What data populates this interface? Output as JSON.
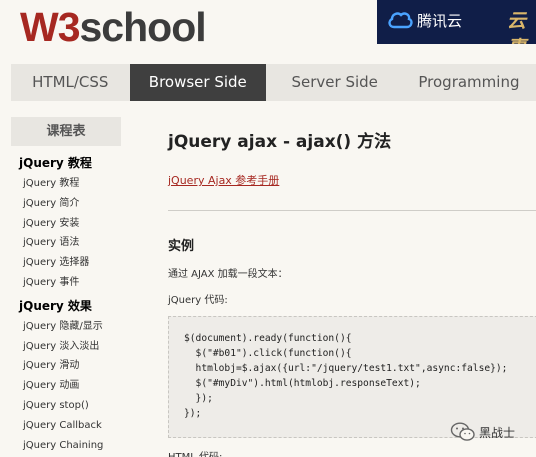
{
  "header": {
    "logo_w3": "W3",
    "logo_school": "school",
    "ad_text": "腾讯云",
    "ad_slogan": "云惠"
  },
  "nav": {
    "tabs": [
      {
        "label": "HTML/CSS",
        "active": false
      },
      {
        "label": "Browser Side",
        "active": true
      },
      {
        "label": "Server Side",
        "active": false
      },
      {
        "label": "Programming",
        "active": false
      }
    ]
  },
  "sidebar": {
    "header": "课程表",
    "groups": [
      {
        "title": "jQuery 教程",
        "items": [
          "jQuery 教程",
          "jQuery 简介",
          "jQuery 安装",
          "jQuery 语法",
          "jQuery 选择器",
          "jQuery 事件"
        ]
      },
      {
        "title": "jQuery 效果",
        "items": [
          "jQuery 隐藏/显示",
          "jQuery 淡入淡出",
          "jQuery 滑动",
          "jQuery 动画",
          "jQuery stop()",
          "jQuery Callback",
          "jQuery Chaining"
        ]
      }
    ]
  },
  "main": {
    "title": "jQuery ajax - ajax() 方法",
    "ref_link": "jQuery Ajax 参考手册",
    "example_heading": "实例",
    "description": "通过 AJAX 加载一段文本：",
    "code_label": "jQuery 代码:",
    "code_lines": [
      "$(document).ready(function(){",
      "  $(\"#b01\").click(function(){",
      "  htmlobj=$.ajax({url:\"/jquery/test1.txt\",async:false});",
      "  $(\"#myDiv\").html(htmlobj.responseText);",
      "  });",
      "});"
    ],
    "html_label": "HTML 代码:"
  },
  "watermark": {
    "text": "黑战士"
  },
  "colors": {
    "brand_red": "#a62821",
    "nav_active": "#3f3f3f",
    "nav_bg": "#e8e6e1",
    "page_bg": "#f9f7f2"
  }
}
